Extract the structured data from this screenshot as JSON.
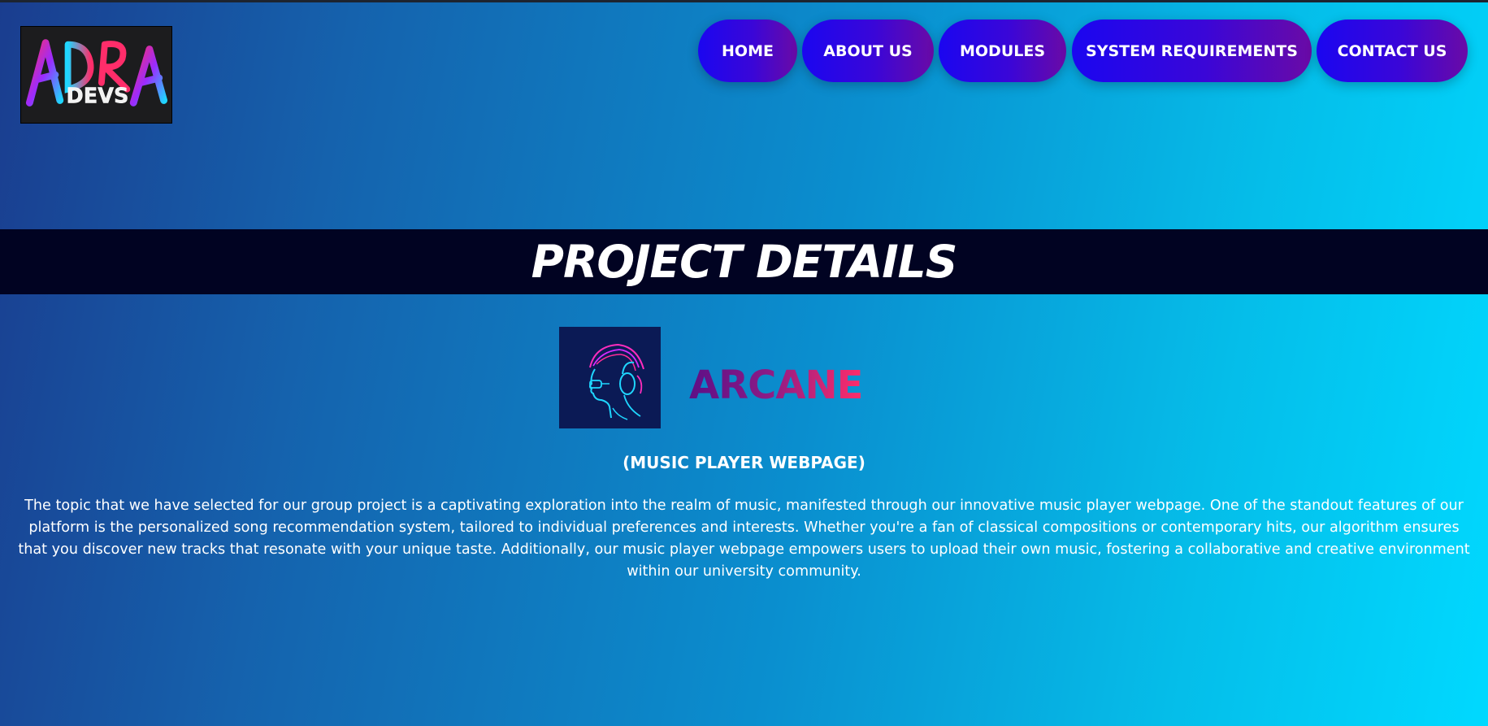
{
  "logo": {
    "primary_text": "ADRA",
    "secondary_text": "DEVS"
  },
  "nav": {
    "items": [
      {
        "label": "HOME"
      },
      {
        "label": "ABOUT US"
      },
      {
        "label": "MODULES"
      },
      {
        "label": "SYSTEM REQUIREMENTS"
      },
      {
        "label": "CONTACT US"
      }
    ]
  },
  "banner": {
    "title": "PROJECT DETAILS"
  },
  "project": {
    "name": "ARCANE",
    "subtitle": "(MUSIC PLAYER WEBPAGE)",
    "description": "The topic that we have selected for our group project is a captivating exploration into the realm of music, manifested through our innovative music player webpage. One of the standout features of our platform is the personalized song recommendation system, tailored to individual preferences and interests. Whether you're a fan of classical compositions or contemporary hits, our algorithm ensures that you discover new tracks that resonate with your unique taste. Additionally, our music player webpage empowers users to upload their own music, fostering a collaborative and creative environment within our university community.",
    "art_icon": "headphones-listener-icon"
  },
  "colors": {
    "background_start": "#1a3d8f",
    "background_end": "#00d9ff",
    "banner_bg": "#010322",
    "nav_gradient_start": "#1b06f0",
    "nav_gradient_end": "#6a0aa6",
    "project_name_start": "#5e0f86",
    "project_name_end": "#ff2d6a"
  }
}
